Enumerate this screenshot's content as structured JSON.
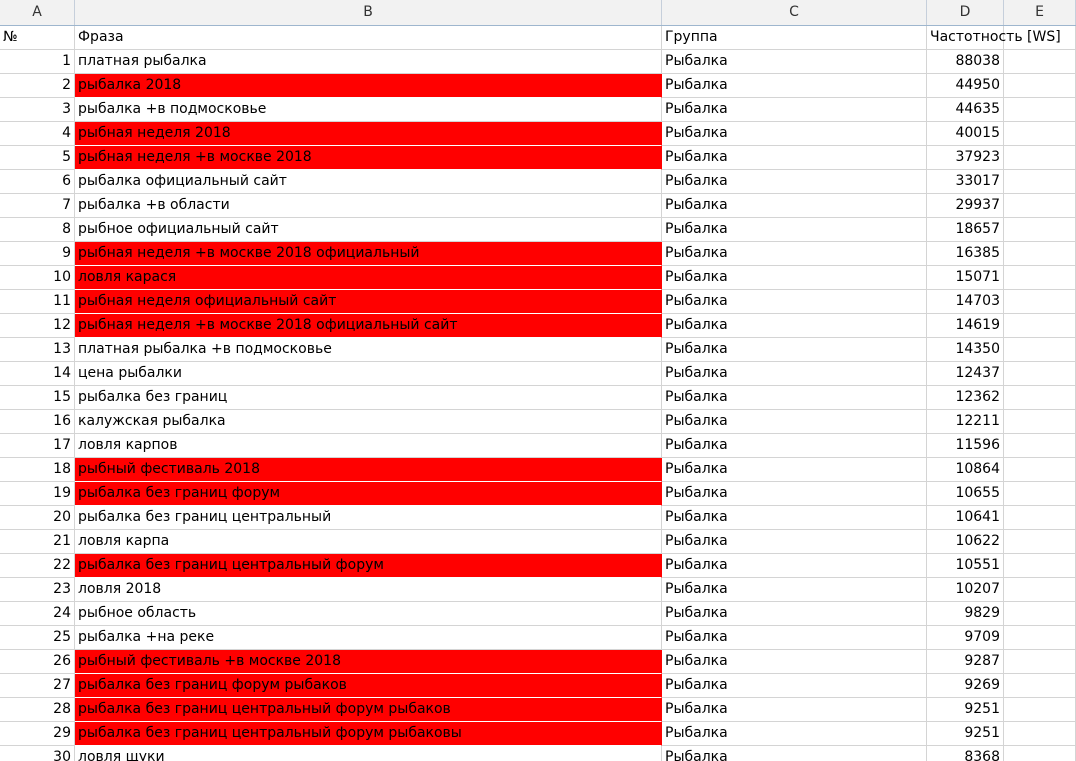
{
  "columns": [
    "A",
    "B",
    "C",
    "D",
    "E"
  ],
  "header": {
    "num": "№",
    "phrase": "Фраза",
    "group": "Группа",
    "freq": "Частотность [WS]"
  },
  "highlight_color": "#ff0000",
  "rows": [
    {
      "n": "1",
      "phrase": "платная рыбалка",
      "group": "Рыбалка",
      "freq": "88038",
      "hl": false
    },
    {
      "n": "2",
      "phrase": "рыбалка 2018",
      "group": "Рыбалка",
      "freq": "44950",
      "hl": true
    },
    {
      "n": "3",
      "phrase": "рыбалка +в подмосковье",
      "group": "Рыбалка",
      "freq": "44635",
      "hl": false
    },
    {
      "n": "4",
      "phrase": "рыбная неделя 2018",
      "group": "Рыбалка",
      "freq": "40015",
      "hl": true
    },
    {
      "n": "5",
      "phrase": "рыбная неделя +в москве 2018",
      "group": "Рыбалка",
      "freq": "37923",
      "hl": true
    },
    {
      "n": "6",
      "phrase": "рыбалка официальный сайт",
      "group": "Рыбалка",
      "freq": "33017",
      "hl": false
    },
    {
      "n": "7",
      "phrase": "рыбалка +в области",
      "group": "Рыбалка",
      "freq": "29937",
      "hl": false
    },
    {
      "n": "8",
      "phrase": "рыбное официальный сайт",
      "group": "Рыбалка",
      "freq": "18657",
      "hl": false
    },
    {
      "n": "9",
      "phrase": "рыбная неделя +в москве 2018 официальный",
      "group": "Рыбалка",
      "freq": "16385",
      "hl": true
    },
    {
      "n": "10",
      "phrase": "ловля карася",
      "group": "Рыбалка",
      "freq": "15071",
      "hl": true
    },
    {
      "n": "11",
      "phrase": "рыбная неделя официальный сайт",
      "group": "Рыбалка",
      "freq": "14703",
      "hl": true
    },
    {
      "n": "12",
      "phrase": "рыбная неделя +в москве 2018 официальный сайт",
      "group": "Рыбалка",
      "freq": "14619",
      "hl": true
    },
    {
      "n": "13",
      "phrase": "платная рыбалка +в подмосковье",
      "group": "Рыбалка",
      "freq": "14350",
      "hl": false
    },
    {
      "n": "14",
      "phrase": "цена рыбалки",
      "group": "Рыбалка",
      "freq": "12437",
      "hl": false
    },
    {
      "n": "15",
      "phrase": "рыбалка без границ",
      "group": "Рыбалка",
      "freq": "12362",
      "hl": false
    },
    {
      "n": "16",
      "phrase": "калужская рыбалка",
      "group": "Рыбалка",
      "freq": "12211",
      "hl": false
    },
    {
      "n": "17",
      "phrase": "ловля карпов",
      "group": "Рыбалка",
      "freq": "11596",
      "hl": false
    },
    {
      "n": "18",
      "phrase": "рыбный фестиваль 2018",
      "group": "Рыбалка",
      "freq": "10864",
      "hl": true
    },
    {
      "n": "19",
      "phrase": "рыбалка без границ форум",
      "group": "Рыбалка",
      "freq": "10655",
      "hl": true
    },
    {
      "n": "20",
      "phrase": "рыбалка без границ центральный",
      "group": "Рыбалка",
      "freq": "10641",
      "hl": false
    },
    {
      "n": "21",
      "phrase": "ловля карпа",
      "group": "Рыбалка",
      "freq": "10622",
      "hl": false
    },
    {
      "n": "22",
      "phrase": "рыбалка без границ центральный форум",
      "group": "Рыбалка",
      "freq": "10551",
      "hl": true
    },
    {
      "n": "23",
      "phrase": "ловля 2018",
      "group": "Рыбалка",
      "freq": "10207",
      "hl": false
    },
    {
      "n": "24",
      "phrase": "рыбное область",
      "group": "Рыбалка",
      "freq": "9829",
      "hl": false
    },
    {
      "n": "25",
      "phrase": "рыбалка +на реке",
      "group": "Рыбалка",
      "freq": "9709",
      "hl": false
    },
    {
      "n": "26",
      "phrase": "рыбный фестиваль +в москве 2018",
      "group": "Рыбалка",
      "freq": "9287",
      "hl": true
    },
    {
      "n": "27",
      "phrase": "рыбалка без границ форум рыбаков",
      "group": "Рыбалка",
      "freq": "9269",
      "hl": true
    },
    {
      "n": "28",
      "phrase": "рыбалка без границ центральный форум рыбаков",
      "group": "Рыбалка",
      "freq": "9251",
      "hl": true
    },
    {
      "n": "29",
      "phrase": "рыбалка без границ центральный форум рыбаковы",
      "group": "Рыбалка",
      "freq": "9251",
      "hl": true
    },
    {
      "n": "30",
      "phrase": "ловля щуки",
      "group": "Рыбалка",
      "freq": "8368",
      "hl": false
    }
  ]
}
